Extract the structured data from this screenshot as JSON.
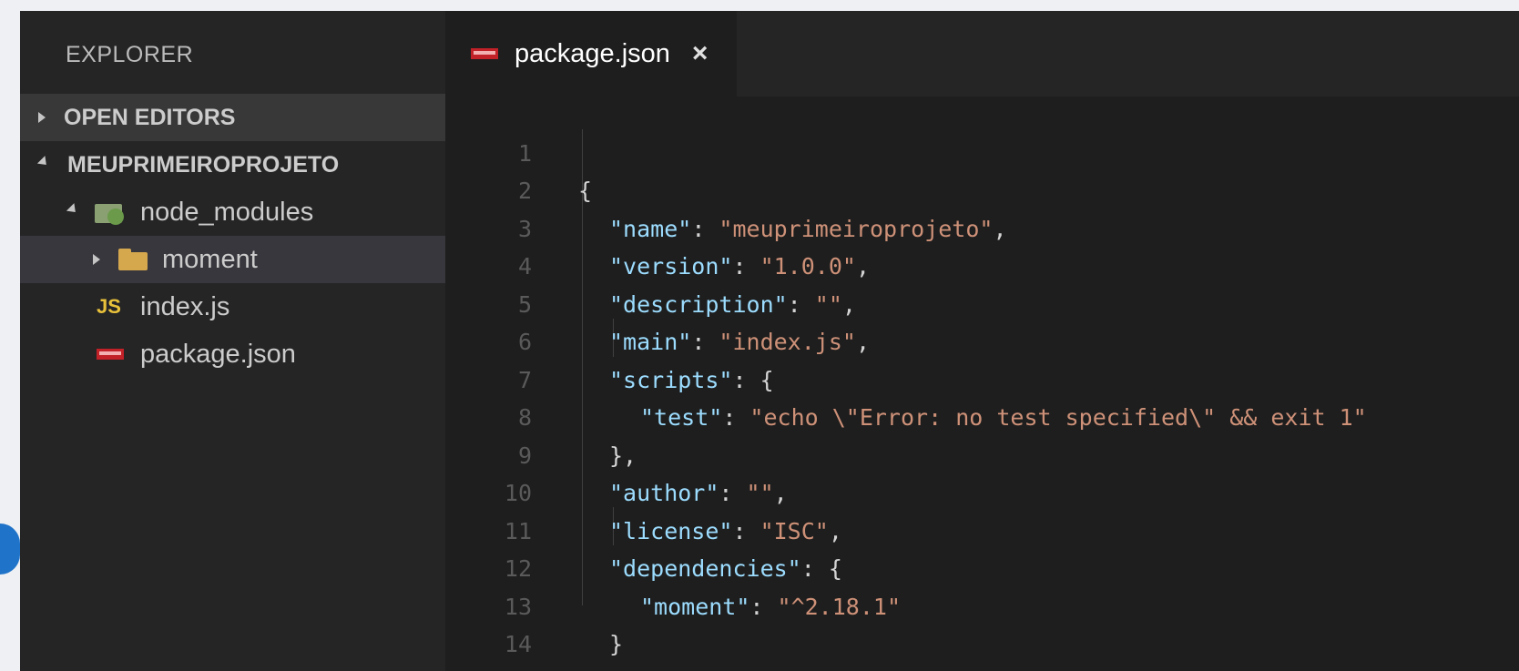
{
  "explorer": {
    "title": "EXPLORER",
    "sections": {
      "open_editors": "OPEN EDITORS",
      "project": "MEUPRIMEIROPROJETO"
    },
    "tree": [
      {
        "label": "node_modules",
        "icon": "node-modules-folder-icon"
      },
      {
        "label": "moment",
        "icon": "folder-icon"
      },
      {
        "label": "index.js",
        "icon": "js-file-icon",
        "icon_text": "JS"
      },
      {
        "label": "package.json",
        "icon": "npm-file-icon"
      }
    ]
  },
  "tab": {
    "label": "package.json",
    "close": "×"
  },
  "editor": {
    "lines": [
      {
        "n": "1"
      },
      {
        "n": "2"
      },
      {
        "n": "3"
      },
      {
        "n": "4"
      },
      {
        "n": "5"
      },
      {
        "n": "6"
      },
      {
        "n": "7"
      },
      {
        "n": "8"
      },
      {
        "n": "9"
      },
      {
        "n": "10"
      },
      {
        "n": "11"
      },
      {
        "n": "12"
      },
      {
        "n": "13"
      },
      {
        "n": "14"
      }
    ],
    "tokens": {
      "open_brace": "{",
      "close_brace": "}",
      "name_key": "\"name\"",
      "name_val": "\"meuprimeiroprojeto\"",
      "version_key": "\"version\"",
      "version_val": "\"1.0.0\"",
      "description_key": "\"description\"",
      "description_val": "\"\"",
      "main_key": "\"main\"",
      "main_val": "\"index.js\"",
      "scripts_key": "\"scripts\"",
      "test_key": "\"test\"",
      "test_val": "\"echo \\\"Error: no test specified\\\" && exit 1\"",
      "scripts_close": "},",
      "author_key": "\"author\"",
      "author_val": "\"\"",
      "license_key": "\"license\"",
      "license_val": "\"ISC\"",
      "dependencies_key": "\"dependencies\"",
      "moment_key": "\"moment\"",
      "moment_val": "\"^2.18.1\"",
      "deps_close": "}"
    }
  }
}
